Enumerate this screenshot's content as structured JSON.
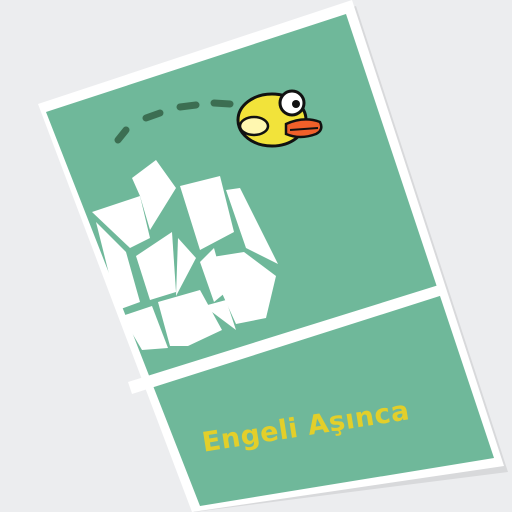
{
  "card": {
    "caption": "Engeli Aşınca",
    "colors": {
      "background": "#ecedef",
      "card_border": "#ffffff",
      "card_fill": "#6fb89a",
      "rock": "#ffffff",
      "ground_line": "#ffffff",
      "dash_trail": "#3c6e52",
      "bird_body": "#f2e33a",
      "bird_beak": "#f0602a",
      "caption_text": "#e3cf2a"
    },
    "icons": [
      "flappy-bird-icon",
      "rock-obstacle-icon",
      "jump-trail-icon",
      "ground-line-icon"
    ]
  }
}
